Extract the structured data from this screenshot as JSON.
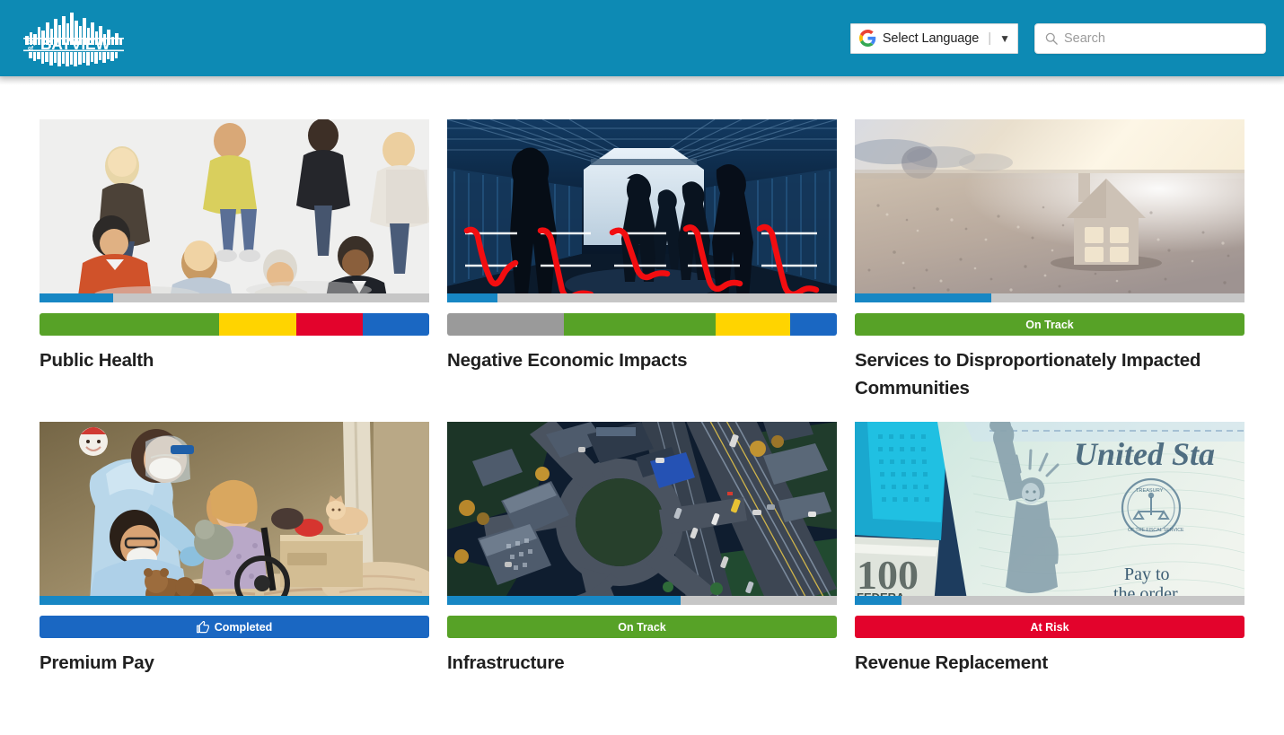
{
  "header": {
    "logo": {
      "line1": "City",
      "line2": "of",
      "wordmark": "BAYVIEW",
      "icon": "city-skyline-icon",
      "background_color": "#0d8ab4"
    },
    "translate": {
      "label": "Select Language",
      "separator": "|",
      "caret": "▼",
      "icon": "google-g-icon"
    },
    "search": {
      "placeholder": "Search",
      "value": "",
      "icon": "search-icon"
    }
  },
  "colors": {
    "brand_blue": "#0d8ab4",
    "progress_fill": "#1787c4",
    "progress_track": "#c6c6c6",
    "status_green": "#57a227",
    "status_yellow": "#ffd400",
    "status_red": "#e3032c",
    "status_blue": "#1a67c2",
    "status_gray": "#9a9a9a"
  },
  "cards": [
    {
      "title": "Public Health",
      "image_alt": "diverse-group-of-people-viewed-from-above",
      "progress_percent": 19,
      "status_segments": [
        {
          "label": "",
          "color": "green",
          "width_percent": 46
        },
        {
          "label": "",
          "color": "yellow",
          "width_percent": 20
        },
        {
          "label": "",
          "color": "red",
          "width_percent": 17
        },
        {
          "label": "",
          "color": "blue",
          "width_percent": 17
        }
      ]
    },
    {
      "title": "Negative Economic Impacts",
      "image_alt": "pedestrian-tunnel-silhouettes-with-declining-red-chart-lines",
      "progress_percent": 13,
      "status_segments": [
        {
          "label": "",
          "color": "gray",
          "width_percent": 30
        },
        {
          "label": "",
          "color": "green",
          "width_percent": 39
        },
        {
          "label": "",
          "color": "yellow",
          "width_percent": 19
        },
        {
          "label": "",
          "color": "blue",
          "width_percent": 12
        }
      ]
    },
    {
      "title": "Services to Disproportionately Impacted Communities",
      "image_alt": "wooden-house-cutout-on-sand-at-sunset",
      "progress_percent": 35,
      "status_segments": [
        {
          "label": "On Track",
          "color": "green",
          "width_percent": 100
        }
      ]
    },
    {
      "title": "Premium Pay",
      "image_alt": "healthcare-workers-in-ppe-with-elderly-patient",
      "progress_percent": 100,
      "status_segments": [
        {
          "label": "Completed",
          "color": "blue",
          "width_percent": 100,
          "icon": "thumbs-up-icon"
        }
      ]
    },
    {
      "title": "Infrastructure",
      "image_alt": "aerial-view-of-roundabout-and-highway-interchange",
      "progress_percent": 60,
      "status_segments": [
        {
          "label": "On Track",
          "color": "green",
          "width_percent": 100
        }
      ]
    },
    {
      "title": "Revenue Replacement",
      "image_alt": "us-treasury-check-with-statue-of-liberty-and-hundred-dollar-bill",
      "progress_percent": 12,
      "status_segments": [
        {
          "label": "At Risk",
          "color": "red",
          "width_percent": 100
        }
      ]
    }
  ]
}
